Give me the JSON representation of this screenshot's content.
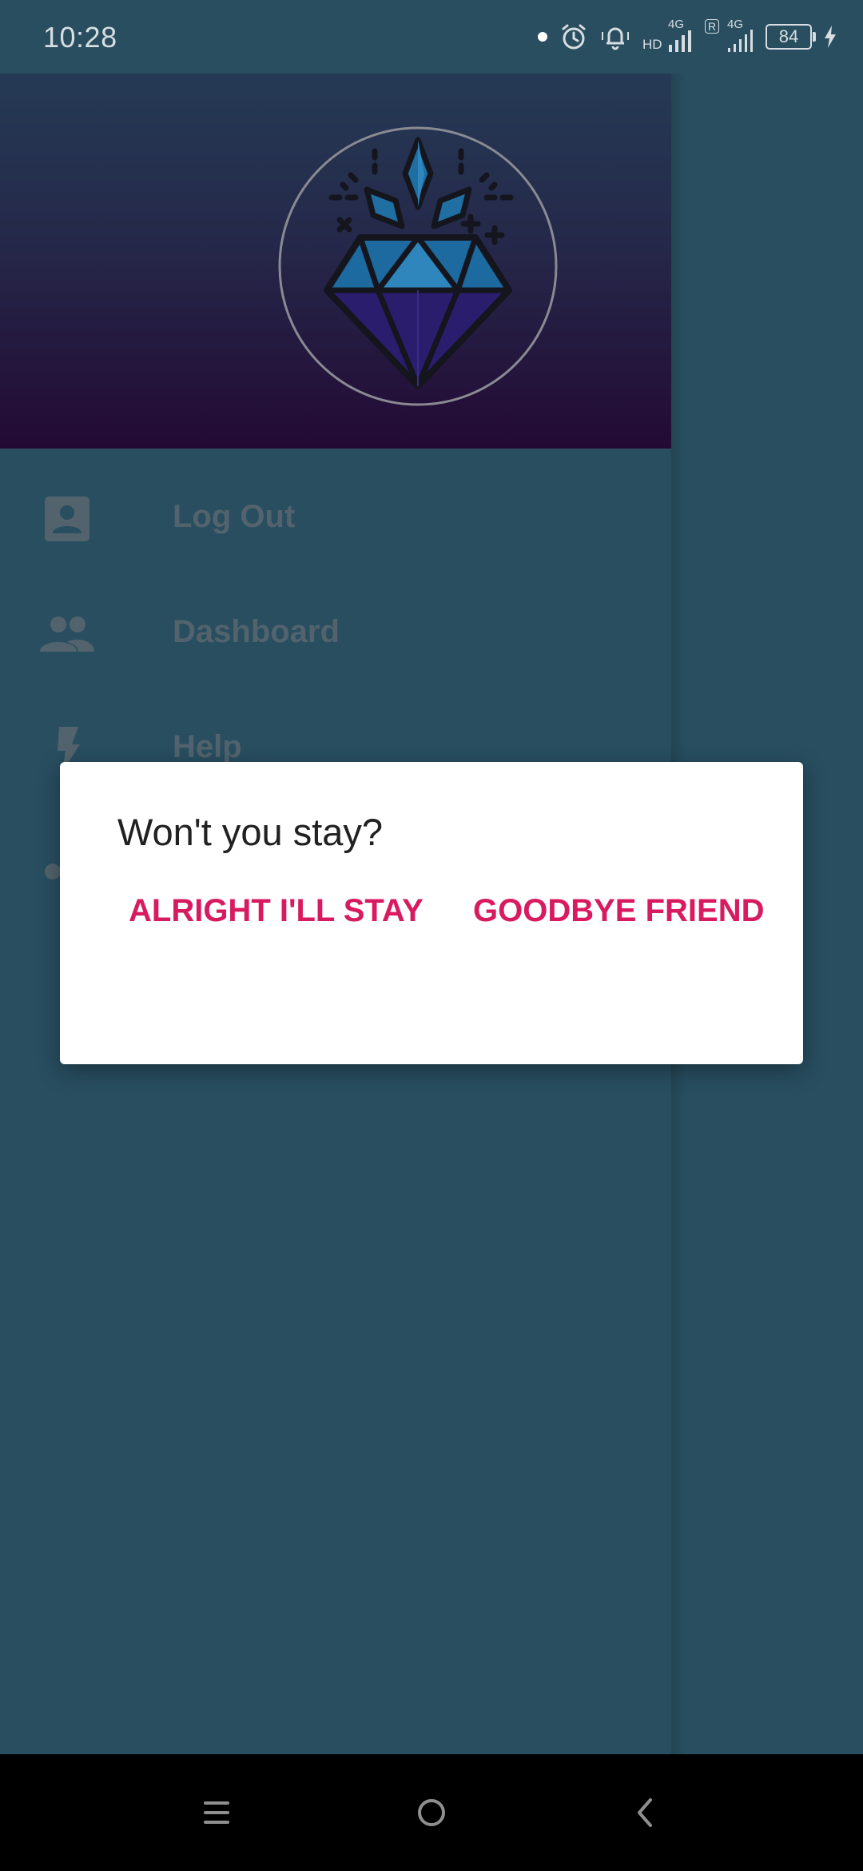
{
  "status_bar": {
    "time": "10:28",
    "network_label": "4G",
    "hd_label": "HD",
    "roaming_label": "R",
    "network_label_2": "4G",
    "battery": "84"
  },
  "drawer": {
    "header_gradient": [
      "#253a55",
      "#230a35"
    ],
    "logo_icon": "diamond-logo-icon",
    "items": [
      {
        "icon": "account-box-icon",
        "label": "Log Out"
      },
      {
        "icon": "people-icon",
        "label": "Dashboard"
      },
      {
        "icon": "flash-icon",
        "label": "Help"
      }
    ]
  },
  "dialog": {
    "title": "Won't you stay?",
    "positive_label": "ALRIGHT I'LL STAY",
    "negative_label": "GOODBYE FRIEND",
    "accent_color": "#d81b60"
  },
  "nav_bar": {
    "icons": [
      "menu-icon",
      "home-circle-icon",
      "back-icon"
    ]
  }
}
